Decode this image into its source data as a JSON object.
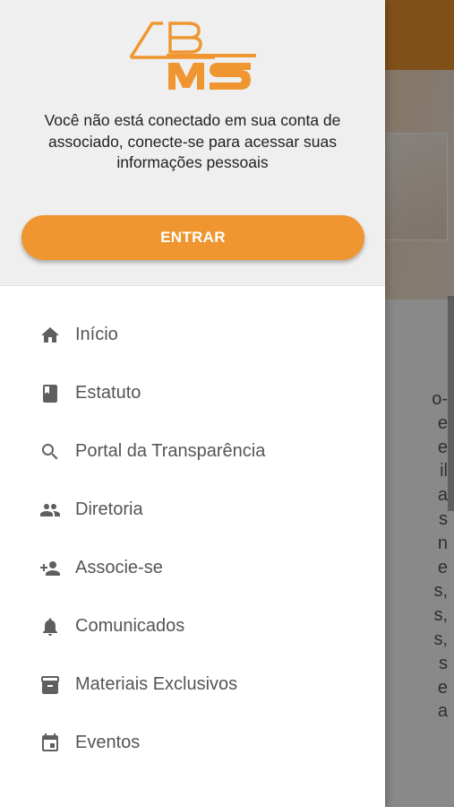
{
  "drawer": {
    "logo": {
      "text": "ABMS",
      "color": "#ef9631"
    },
    "message": "Você não está conectado em sua conta de associado, conecte-se para acessar suas informações pessoais",
    "enter_button": "ENTRAR"
  },
  "menu": {
    "items": [
      {
        "label": "Início",
        "icon": "home-icon"
      },
      {
        "label": "Estatuto",
        "icon": "book-icon"
      },
      {
        "label": "Portal da Transparência",
        "icon": "search-icon"
      },
      {
        "label": "Diretoria",
        "icon": "people-icon"
      },
      {
        "label": "Associe-se",
        "icon": "person-add-icon"
      },
      {
        "label": "Comunicados",
        "icon": "bell-icon"
      },
      {
        "label": "Materiais Exclusivos",
        "icon": "inbox-icon"
      },
      {
        "label": "Eventos",
        "icon": "calendar-icon"
      }
    ]
  },
  "background": {
    "partial_text": "o-\ne\ne\nil\na\ns\nn\ne\ns,\ns,\ns,\ns\ne\na",
    "accent_color": "#e9932f"
  }
}
